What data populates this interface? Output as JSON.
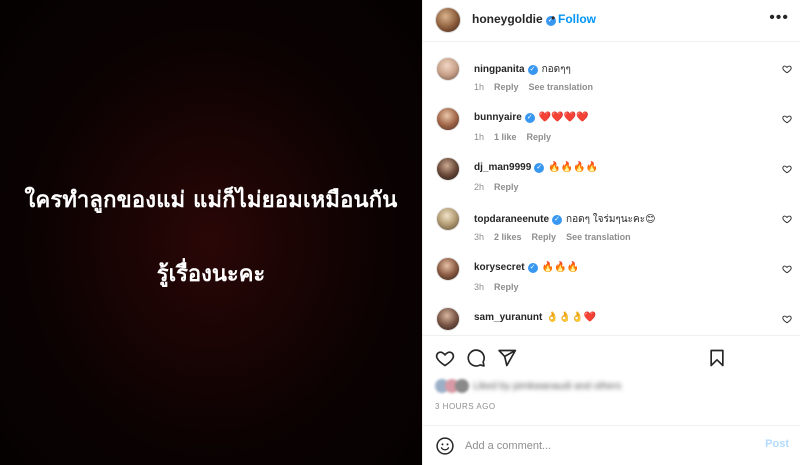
{
  "image": {
    "line1": "ใครทำลูกของแม่ แม่ก็ไม่ยอมเหมือนกัน",
    "line2": "รู้เรื่องนะคะ"
  },
  "header": {
    "username": "honeygoldie",
    "verified_icon": "verified-badge-icon",
    "dot": "•",
    "follow_label": "Follow",
    "more_icon": "more-options-icon"
  },
  "comments": [
    {
      "username": "ningpanita",
      "verified": true,
      "text": "กอดๆๆ",
      "time": "1h",
      "likes": "",
      "reply": "Reply",
      "translate": "See translation"
    },
    {
      "username": "bunnyaire",
      "verified": true,
      "text": "❤️❤️❤️❤️",
      "time": "1h",
      "likes": "1 like",
      "reply": "Reply",
      "translate": ""
    },
    {
      "username": "dj_man9999",
      "verified": true,
      "text": "🔥🔥🔥🔥",
      "time": "2h",
      "likes": "",
      "reply": "Reply",
      "translate": ""
    },
    {
      "username": "topdaraneenute",
      "verified": true,
      "text": "กอดๆ ใจร่มๆนะคะ😊",
      "time": "3h",
      "likes": "2 likes",
      "reply": "Reply",
      "translate": "See translation"
    },
    {
      "username": "korysecret",
      "verified": true,
      "text": "🔥🔥🔥",
      "time": "3h",
      "likes": "",
      "reply": "Reply",
      "translate": ""
    },
    {
      "username": "sam_yuranunt",
      "verified": false,
      "text": "👌👌👌❤️",
      "time": "",
      "likes": "",
      "reply": "",
      "translate": ""
    }
  ],
  "actions": {
    "like_icon": "heart-icon",
    "comment_icon": "comment-icon",
    "share_icon": "send-icon",
    "save_icon": "bookmark-icon",
    "liked_by_text": "Liked by pimkwanaudi and others",
    "timestamp": "3 HOURS AGO"
  },
  "composer": {
    "emoji_icon": "emoji-icon",
    "placeholder": "Add a comment...",
    "post_label": "Post"
  }
}
